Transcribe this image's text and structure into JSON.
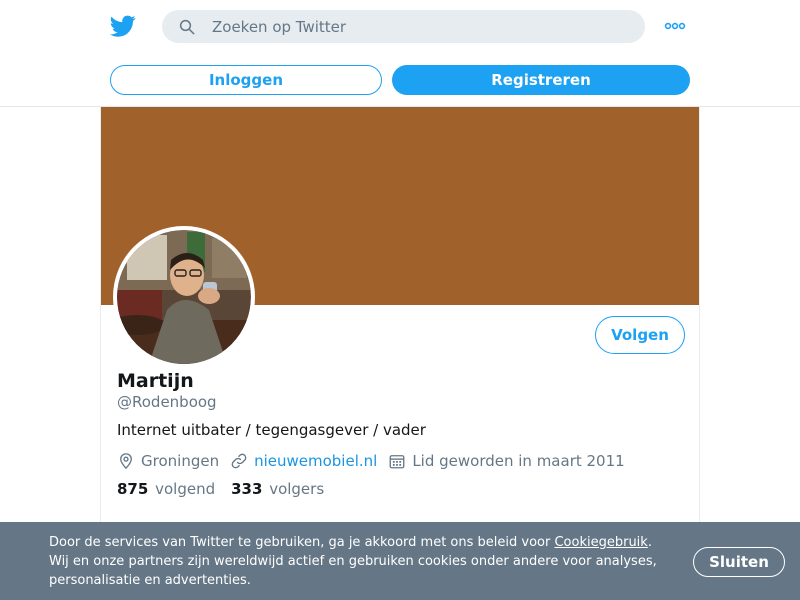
{
  "header": {
    "logo_icon": "twitter-bird-icon",
    "search": {
      "placeholder": "Zoeken op Twitter",
      "icon": "search-icon"
    },
    "more_icon": "more-dots-icon",
    "login_label": "Inloggen",
    "register_label": "Registreren"
  },
  "profile": {
    "banner_color": "#a0622a",
    "avatar_icon": "avatar-photo",
    "follow_label": "Volgen",
    "name": "Martijn",
    "handle": "@Rodenboog",
    "bio": "Internet uitbater / tegengasgever / vader",
    "location": {
      "icon": "location-pin-icon",
      "text": "Groningen"
    },
    "website": {
      "icon": "link-icon",
      "text": "nieuwemobiel.nl"
    },
    "joined": {
      "icon": "calendar-icon",
      "text": "Lid geworden in maart 2011"
    },
    "following": {
      "count": "875",
      "label": "volgend"
    },
    "followers": {
      "count": "333",
      "label": "volgers"
    }
  },
  "cookie_banner": {
    "text_before": "Door de services van Twitter te gebruiken, ga je akkoord met ons beleid voor ",
    "link": "Cookiegebruik",
    "text_after": ". Wij en onze partners zijn wereldwijd actief en gebruiken cookies onder andere voor analyses, personalisatie en advertenties.",
    "close_label": "Sluiten"
  },
  "colors": {
    "accent": "#1da1f2",
    "banner": "#a0622a",
    "cookie_bg": "#657786"
  }
}
